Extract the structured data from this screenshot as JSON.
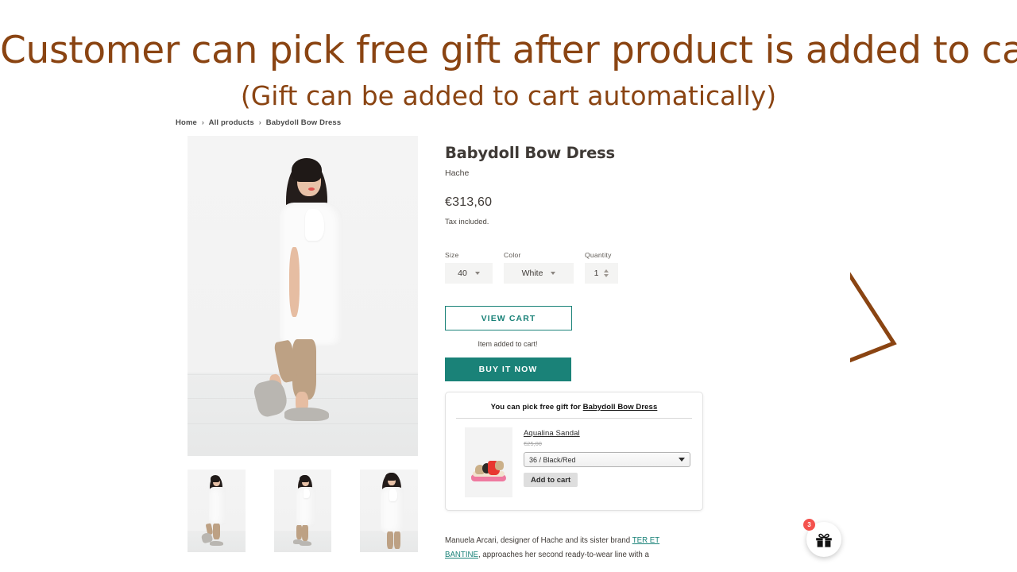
{
  "annotation": {
    "title": "Customer can pick free gift after product is added to cart",
    "subtitle": "(Gift can be added to cart automatically)",
    "color": "#8a4412",
    "arrow_name": "bent-arrow-pointing-to-gift-widget"
  },
  "breadcrumb": {
    "home": "Home",
    "collection": "All products",
    "current": "Babydoll Bow Dress",
    "separator": "›"
  },
  "product": {
    "title": "Babydoll Bow Dress",
    "vendor": "Hache",
    "price": "€313,60",
    "tax_note": "Tax included.",
    "options": [
      {
        "label": "Size",
        "value": "40"
      },
      {
        "label": "Color",
        "value": "White"
      }
    ],
    "quantity": {
      "label": "Quantity",
      "value": "1"
    },
    "view_cart_label": "VIEW CART",
    "added_note": "Item added to cart!",
    "buy_now_label": "BUY IT NOW",
    "accent_color": "#1a8278",
    "description_before": "Manuela Arcari, designer of Hache and its sister brand ",
    "description_link": "TER ET BANTINE",
    "description_after": ", approaches her second ready-to-wear line with a"
  },
  "gallery": {
    "main_alt": "model-wearing-white-babydoll-bow-dress",
    "thumbs": [
      "thumbnail-side-view",
      "thumbnail-front-view",
      "thumbnail-front-closeup"
    ]
  },
  "gift_widget": {
    "heading_prefix": "You can pick free gift for ",
    "heading_product": "Babydoll Bow Dress",
    "gift": {
      "name": "Aqualina Sandal",
      "original_price": "€25,00",
      "variant_selected": "36 / Black/Red",
      "add_to_cart_label": "Add to cart",
      "image_alt": "red-and-beige-sandal"
    }
  },
  "floating_gift_button": {
    "icon": "gift-icon",
    "badge_count": "3",
    "badge_color": "#f4524d"
  }
}
